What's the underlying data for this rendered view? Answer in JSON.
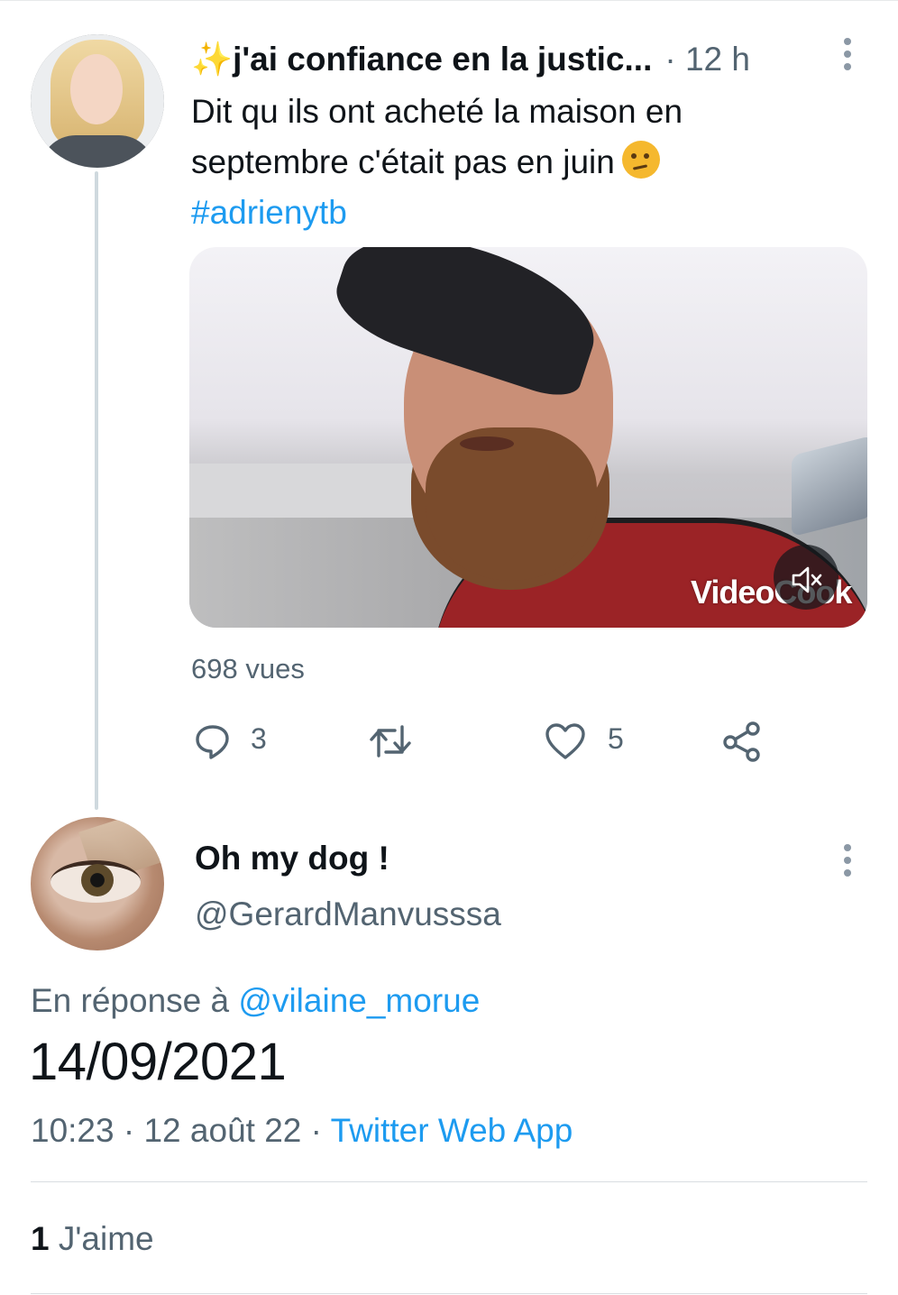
{
  "tweet1": {
    "display_name": "✨j'ai confiance en la justic...",
    "separator": "·",
    "time": "12 h",
    "text": "Dit qu ils ont acheté la maison en septembre c'était pas en juin",
    "emoji": "thinking-face",
    "hashtag": "#adrienytb",
    "video": {
      "watermark": "VideoCook",
      "mute_icon": "speaker-muted-icon"
    },
    "views": "698 vues",
    "actions": {
      "reply_count": "3",
      "retweet_count": "",
      "like_count": "5"
    }
  },
  "tweet2": {
    "display_name": "Oh my dog !",
    "handle": "@GerardManvusssa",
    "reply_prefix": "En réponse à",
    "reply_mention": "@vilaine_morue",
    "text": "14/09/2021",
    "time": "10:23",
    "date": "12 août 22",
    "source": "Twitter Web App",
    "meta_separator": "·",
    "likes_count": "1",
    "likes_label": "J'aime"
  },
  "colors": {
    "accent": "#1d9bf0",
    "secondary_text": "#536471",
    "primary_text": "#0f1419",
    "thread_line": "#cfd9de"
  }
}
